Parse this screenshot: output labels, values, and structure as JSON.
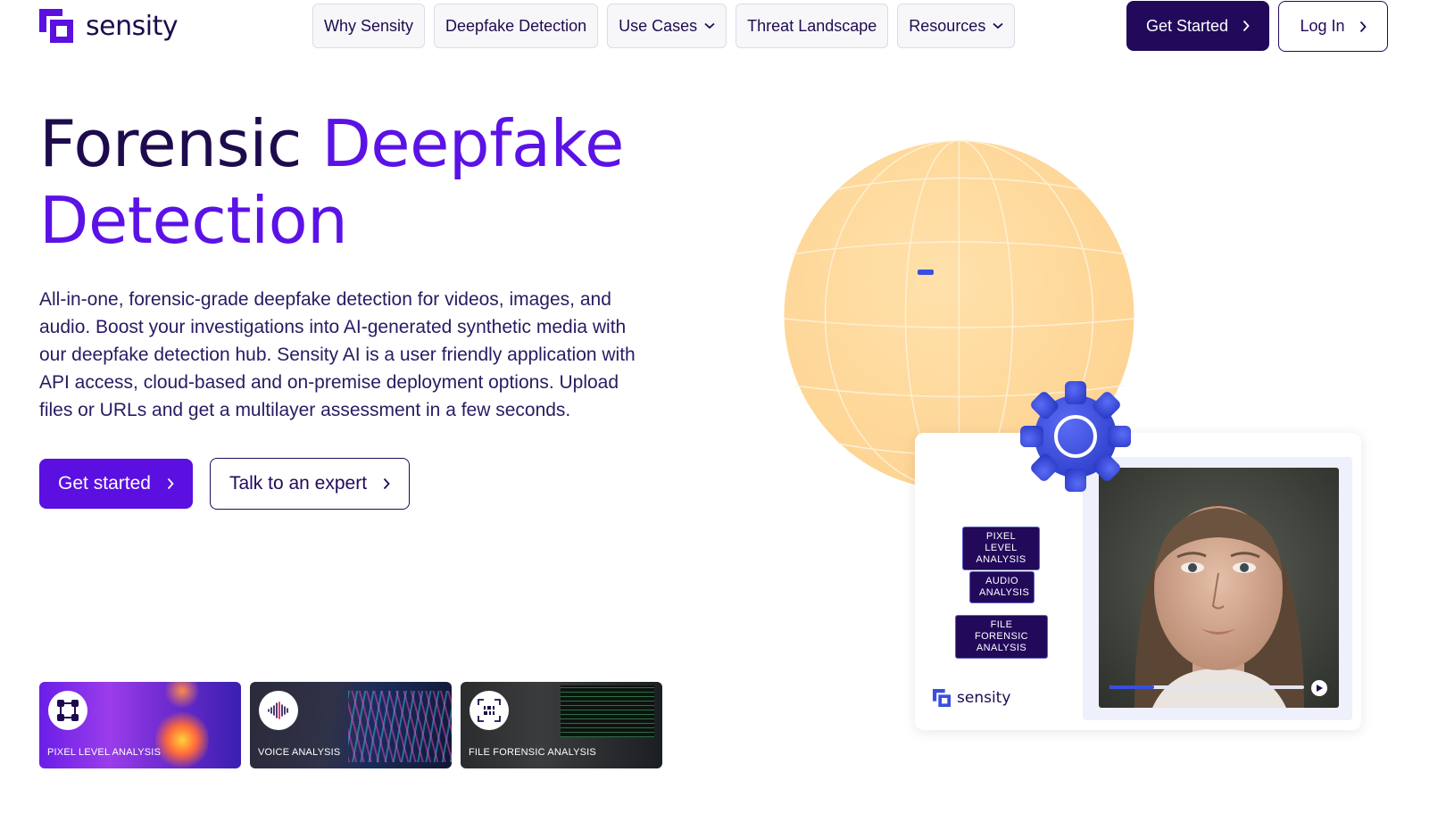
{
  "header": {
    "logo_text": "sensity",
    "nav": [
      {
        "label": "Why Sensity",
        "has_dropdown": false
      },
      {
        "label": "Deepfake Detection",
        "has_dropdown": false
      },
      {
        "label": "Use Cases",
        "has_dropdown": true
      },
      {
        "label": "Threat Landscape",
        "has_dropdown": false
      },
      {
        "label": "Resources",
        "has_dropdown": true
      }
    ],
    "get_started_label": "Get Started",
    "login_label": "Log In"
  },
  "hero": {
    "title_part1": "Forensic ",
    "title_part2": "Deepfake Detection",
    "description": "All-in-one, forensic-grade deepfake detection for videos, images, and audio. Boost your investigations into AI-generated synthetic media with our deepfake detection hub. Sensity AI is a user friendly application with API access, cloud-based and on-premise deployment options. Upload files or URLs and get a multilayer assessment in a few seconds.",
    "primary_cta": "Get started",
    "secondary_cta": "Talk to an expert"
  },
  "cards": [
    {
      "label": "PIXEL LEVEL ANALYSIS",
      "icon": "nodes-icon"
    },
    {
      "label": "VOICE ANALYSIS",
      "icon": "waveform-icon"
    },
    {
      "label": "FILE FORENSIC ANALYSIS",
      "icon": "binary-scan-icon"
    }
  ],
  "illustration": {
    "chips": [
      "PIXEL LEVEL ANALYSIS",
      "AUDIO ANALYSIS",
      "FILE FORENSIC ANALYSIS"
    ],
    "panel_logo_text": "sensity",
    "video_progress": 0.23
  },
  "colors": {
    "brand_dark": "#22095a",
    "brand_purple": "#5b0fe0",
    "accent_text": "#5b12e6",
    "globe": "#ffd89a",
    "gear": "#3a4ee0"
  }
}
